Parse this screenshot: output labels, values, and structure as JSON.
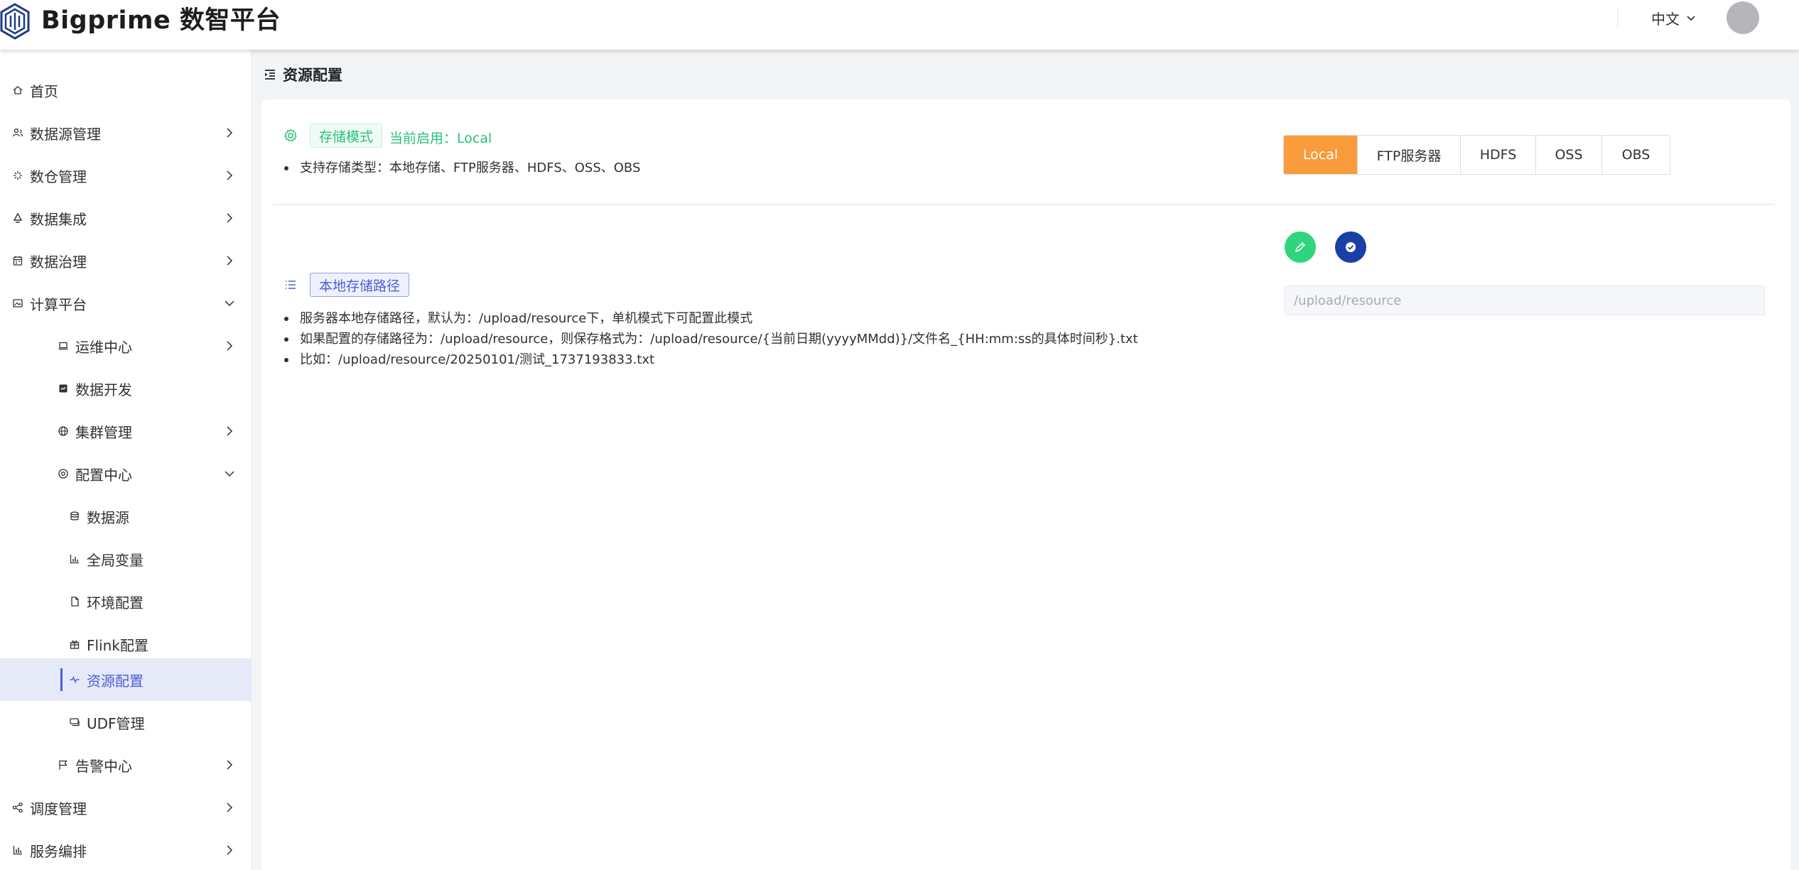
{
  "header": {
    "brand": "Bigprime 数智平台",
    "language": "中文"
  },
  "sidebar": {
    "items": [
      {
        "label": "首页"
      },
      {
        "label": "数据源管理"
      },
      {
        "label": "数仓管理"
      },
      {
        "label": "数据集成"
      },
      {
        "label": "数据治理"
      },
      {
        "label": "计算平台"
      },
      {
        "label": "运维中心"
      },
      {
        "label": "数据开发"
      },
      {
        "label": "集群管理"
      },
      {
        "label": "配置中心"
      },
      {
        "label": "数据源"
      },
      {
        "label": "全局变量"
      },
      {
        "label": "环境配置"
      },
      {
        "label": "Flink配置"
      },
      {
        "label": "资源配置"
      },
      {
        "label": "UDF管理"
      },
      {
        "label": "告警中心"
      },
      {
        "label": "调度管理"
      },
      {
        "label": "服务编排"
      }
    ]
  },
  "breadcrumb": {
    "title": "资源配置"
  },
  "storage": {
    "tag": "存储模式",
    "current": "当前启用：Local",
    "bullets": [
      "支持存储类型：本地存储、FTP服务器、HDFS、OSS、OBS"
    ],
    "options": [
      "Local",
      "FTP服务器",
      "HDFS",
      "OSS",
      "OBS"
    ],
    "selected": "Local"
  },
  "local_path": {
    "tag": "本地存储路径",
    "bullets": [
      "服务器本地存储路径，默认为：/upload/resource下，单机模式下可配置此模式",
      "如果配置的存储路径为：/upload/resource，则保存格式为：/upload/resource/{当前日期(yyyyMMdd)}/文件名_{HH:mm:ss的具体时间秒}.txt",
      "比如：/upload/resource/20250101/测试_1737193833.txt"
    ],
    "placeholder": "/upload/resource"
  },
  "colors": {
    "accent": "#4c5fd5",
    "selected_option": "#fa9b3c",
    "tag_green": "#27c27a",
    "edit_button": "#2fd57c",
    "confirm_button": "#1a3fa6"
  }
}
